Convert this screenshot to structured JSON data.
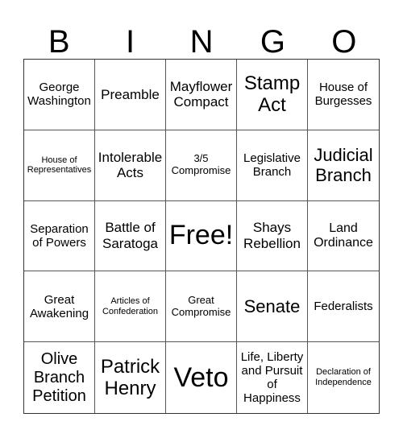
{
  "header": [
    "B",
    "I",
    "N",
    "G",
    "O"
  ],
  "cells": [
    {
      "text": "George Washington",
      "size": "s15"
    },
    {
      "text": "Preamble",
      "size": "s17"
    },
    {
      "text": "Mayflower Compact",
      "size": "s17"
    },
    {
      "text": "Stamp Act",
      "size": "s24"
    },
    {
      "text": "House of Burgesses",
      "size": "s15"
    },
    {
      "text": "House of Representatives",
      "size": "s11"
    },
    {
      "text": "Intolerable Acts",
      "size": "s17"
    },
    {
      "text": "3/5 Compromise",
      "size": "s13"
    },
    {
      "text": "Legislative Branch",
      "size": "s15"
    },
    {
      "text": "Judicial Branch",
      "size": "s22"
    },
    {
      "text": "Separation of Powers",
      "size": "s15"
    },
    {
      "text": "Battle of Saratoga",
      "size": "s17"
    },
    {
      "text": "Free!",
      "size": "s34"
    },
    {
      "text": "Shays Rebellion",
      "size": "s17"
    },
    {
      "text": "Land Ordinance",
      "size": "s16"
    },
    {
      "text": "Great Awakening",
      "size": "s15"
    },
    {
      "text": "Articles of Confederation",
      "size": "s11"
    },
    {
      "text": "Great Compromise",
      "size": "s13"
    },
    {
      "text": "Senate",
      "size": "s22"
    },
    {
      "text": "Federalists",
      "size": "s15"
    },
    {
      "text": "Olive Branch Petition",
      "size": "s20"
    },
    {
      "text": "Patrick Henry",
      "size": "s24"
    },
    {
      "text": "Veto",
      "size": "s34"
    },
    {
      "text": "Life, Liberty and Pursuit of Happiness",
      "size": "s15"
    },
    {
      "text": "Declaration of Independence",
      "size": "s11"
    }
  ]
}
